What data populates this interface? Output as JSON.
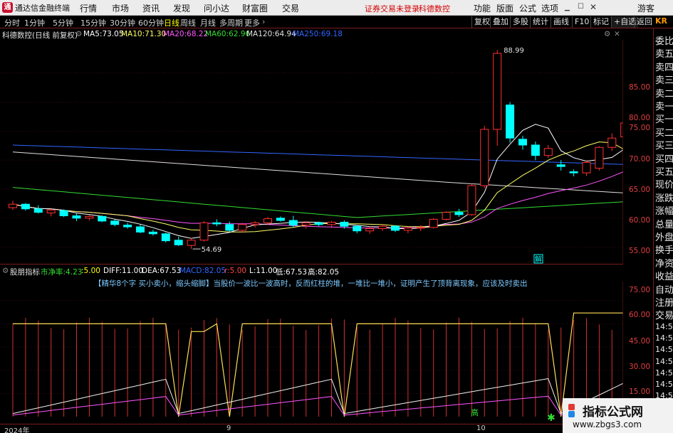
{
  "titlebar": {
    "app_name": "通达信金融终端",
    "menus": [
      "行情",
      "市场",
      "资讯",
      "发现",
      "问小达",
      "财富圈",
      "交易"
    ],
    "notice_login": "证券交易未登录",
    "notice_stock": "科德数控",
    "right_menus": [
      "功能",
      "版面",
      "公式",
      "选项"
    ],
    "user": "游客"
  },
  "toolbar": {
    "periods": [
      "分时",
      "1分钟",
      "5分钟",
      "15分钟",
      "30分钟",
      "60分钟",
      "日线",
      "周线",
      "月线",
      "多周期",
      "更多"
    ],
    "active_period": "日线",
    "right_buttons": [
      "复权",
      "叠加",
      "多股",
      "统计",
      "画线",
      "F10",
      "标记",
      "+自选",
      "返回"
    ]
  },
  "main_chart": {
    "stock_title": "科德数控(日线 前复权)",
    "ma": [
      {
        "label": "MA5:",
        "value": "73.05",
        "color": "#ffffff"
      },
      {
        "label": "MA10:",
        "value": "71.30",
        "color": "#ffff66"
      },
      {
        "label": "MA20:",
        "value": "68.22",
        "color": "#ff55ff"
      },
      {
        "label": "MA60:",
        "value": "62.96",
        "color": "#33dd33"
      },
      {
        "label": "MA120:",
        "value": "64.94",
        "color": "#e0e0e0"
      },
      {
        "label": "MA250:",
        "value": "69.18",
        "color": "#3366ff"
      }
    ],
    "y_ticks": [
      "85.00",
      "80.00",
      "75.00",
      "70.00",
      "65.00",
      "60.00",
      "55.00"
    ],
    "high_label": "88.99",
    "low_label": "54.69",
    "tag_label": "解"
  },
  "sub_chart": {
    "indicator_name": "股朋指标",
    "items": [
      {
        "label": "市净率:",
        "value": "4.23",
        "color": "#33dd33"
      },
      {
        "label": ":",
        "value": "5.00",
        "color": "#ffff00"
      },
      {
        "label": "DIFF:",
        "value": "11.00",
        "color": "#ffffff"
      },
      {
        "label": "DEA:",
        "value": "67.53",
        "color": "#ffffff"
      },
      {
        "label": "MACD:",
        "value": "82.05",
        "color": "#3366ff"
      },
      {
        "label": "r:",
        "value": "5.00",
        "color": "#ff4444"
      },
      {
        "label": "L:",
        "value": "11.00",
        "color": "#ffffff"
      },
      {
        "label": "低:",
        "value": "67.53",
        "color": "#ffffff"
      },
      {
        "label": "高:",
        "value": "82.05",
        "color": "#ffffff"
      }
    ],
    "note": "【精华8个字 买小卖小，缩头缩脚】当股价一波比一波高时，反而红柱的堆，一堆比一堆小，证明产生了顶背离现象，应该及时卖出",
    "y_ticks": [
      "75.00",
      "60.00",
      "45.00",
      "30.00",
      "15.00"
    ],
    "gao_label": "高"
  },
  "right_panel": {
    "header": "KR",
    "labels": [
      "委比",
      "卖五",
      "卖四",
      "卖三",
      "卖二",
      "卖一",
      "买一",
      "买二",
      "买三",
      "买四",
      "买五",
      "现价",
      "涨跌",
      "涨幅",
      "总量",
      "外盘",
      "换手",
      "净资",
      "收益",
      "自动",
      "注册",
      "交易"
    ],
    "times": [
      "14:5",
      "14:5",
      "14:5",
      "14:5",
      "14:5",
      "14:5",
      "14:5",
      "14:5",
      "14:5"
    ]
  },
  "footer": {
    "year_label": "2024年",
    "month_9": "9",
    "month_10": "10"
  },
  "watermark": {
    "title": "指标公式网",
    "url": "www.zbgs3.com"
  },
  "colors": {
    "up": "#ff3030",
    "down": "#00ffff",
    "ma5": "#ffffff",
    "ma10": "#ffff66",
    "ma20": "#ff55ff",
    "ma60": "#33dd33",
    "ma120": "#e0e0e0",
    "ma250": "#3366ff"
  },
  "chart_data": {
    "type": "candlestick",
    "y_range": [
      52.5,
      90
    ],
    "candles": [
      [
        61.8,
        63.0,
        61.4,
        62.4
      ],
      [
        62.4,
        62.6,
        61.3,
        61.6
      ],
      [
        61.6,
        62.2,
        60.8,
        61.0
      ],
      [
        60.9,
        61.6,
        60.3,
        61.4
      ],
      [
        61.3,
        61.5,
        60.2,
        60.4
      ],
      [
        60.4,
        60.8,
        59.5,
        60.0
      ],
      [
        60.0,
        60.5,
        59.6,
        60.3
      ],
      [
        60.3,
        60.5,
        59.3,
        59.5
      ],
      [
        59.5,
        59.8,
        58.6,
        58.9
      ],
      [
        58.8,
        59.2,
        58.2,
        58.5
      ],
      [
        58.5,
        58.9,
        57.4,
        57.6
      ],
      [
        57.6,
        58.0,
        57.0,
        57.3
      ],
      [
        57.3,
        57.5,
        55.8,
        56.1
      ],
      [
        56.2,
        56.8,
        55.2,
        55.4
      ],
      [
        55.3,
        56.6,
        54.69,
        56.2
      ],
      [
        56.2,
        59.5,
        56.0,
        59.2
      ],
      [
        59.2,
        59.8,
        58.6,
        59.0
      ],
      [
        58.9,
        59.4,
        57.6,
        57.9
      ],
      [
        57.9,
        59.2,
        57.5,
        58.9
      ],
      [
        58.9,
        59.5,
        58.4,
        59.2
      ],
      [
        59.2,
        60.2,
        58.8,
        59.9
      ],
      [
        60.0,
        60.3,
        59.4,
        59.6
      ],
      [
        59.6,
        60.4,
        58.4,
        58.8
      ],
      [
        58.8,
        59.5,
        58.2,
        59.2
      ],
      [
        59.2,
        59.4,
        58.6,
        58.9
      ],
      [
        58.9,
        59.5,
        58.3,
        59.3
      ],
      [
        59.3,
        59.6,
        58.2,
        58.6
      ],
      [
        58.6,
        58.8,
        57.4,
        57.8
      ],
      [
        57.8,
        58.6,
        57.3,
        58.2
      ],
      [
        58.2,
        58.9,
        57.8,
        58.6
      ],
      [
        58.6,
        58.8,
        57.6,
        57.9
      ],
      [
        57.9,
        58.5,
        57.4,
        58.3
      ],
      [
        58.3,
        58.8,
        57.8,
        58.4
      ],
      [
        58.4,
        60.0,
        58.2,
        59.8
      ],
      [
        59.8,
        61.2,
        59.6,
        61.0
      ],
      [
        61.0,
        61.6,
        60.2,
        60.6
      ],
      [
        60.6,
        66.0,
        60.4,
        65.6
      ],
      [
        65.6,
        75.9,
        65.2,
        75.3
      ],
      [
        75.3,
        88.99,
        72.5,
        88.4
      ],
      [
        79.5,
        80.0,
        73.0,
        73.8
      ],
      [
        73.6,
        74.2,
        71.8,
        72.6
      ],
      [
        72.6,
        73.2,
        70.0,
        70.8
      ],
      [
        70.8,
        72.6,
        70.4,
        72.0
      ],
      [
        69.2,
        70.0,
        68.2,
        68.9
      ],
      [
        68.0,
        68.4,
        67.2,
        67.8
      ],
      [
        67.8,
        70.0,
        67.3,
        69.6
      ],
      [
        68.6,
        72.4,
        68.2,
        72.2
      ],
      [
        72.2,
        74.6,
        71.6,
        73.8
      ],
      [
        74.0,
        78.5,
        73.5,
        76.4
      ],
      [
        76.4,
        76.8,
        74.6,
        75.6
      ]
    ],
    "sub_y_range": [
      0,
      85
    ]
  }
}
